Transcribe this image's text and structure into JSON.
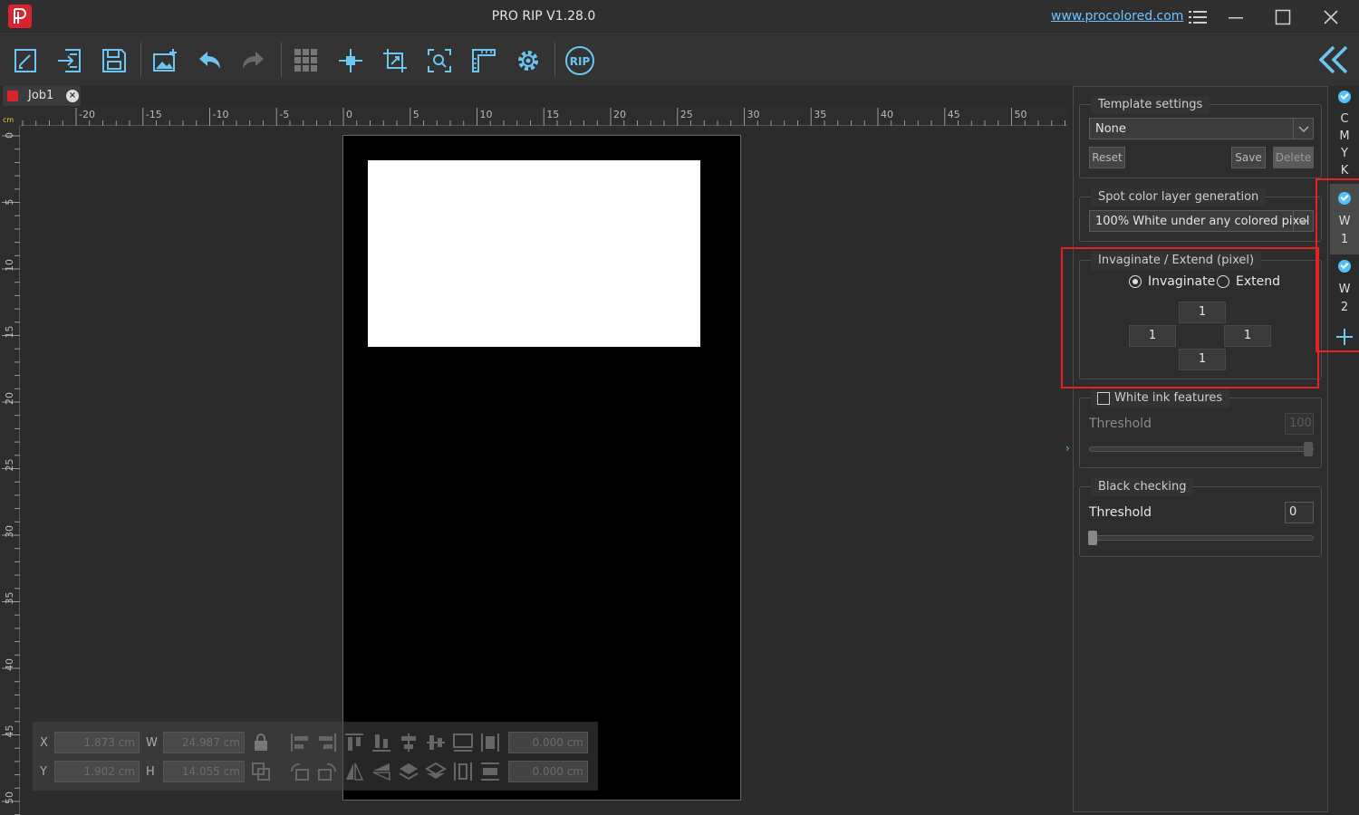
{
  "window": {
    "title": "PRO RIP V1.28.0",
    "website": "www.procolored.com",
    "icons": [
      "menu-icon",
      "minimize-icon",
      "maximize-icon",
      "close-icon"
    ]
  },
  "toolbar": {
    "tools": [
      "new-job-icon",
      "import-icon",
      "save-icon",
      "add-image-icon",
      "undo-icon",
      "redo-icon",
      "grid-icon",
      "center-icon",
      "crop-icon",
      "zoom-fit-icon",
      "ruler-icon",
      "settings-icon",
      "rip-icon"
    ],
    "rip_label": "RIP"
  },
  "tabs": [
    {
      "label": "Job1"
    }
  ],
  "ruler": {
    "unit": "cm",
    "h_labels": [
      "-20",
      "-15",
      "-10",
      "-5",
      "0",
      "5",
      "10",
      "15",
      "20",
      "25",
      "30",
      "35",
      "40",
      "45",
      "50"
    ],
    "v_labels": [
      "0",
      "5",
      "10",
      "15",
      "20",
      "25",
      "30",
      "35",
      "40",
      "45",
      "50"
    ]
  },
  "transform": {
    "x_label": "X",
    "x_value": "1.873 cm",
    "y_label": "Y",
    "y_value": "1.902 cm",
    "w_label": "W",
    "w_value": "24.987 cm",
    "h_label": "H",
    "h_value": "14.055 cm",
    "field1_value": "0.000 cm",
    "field2_value": "0.000 cm"
  },
  "panel": {
    "template": {
      "title": "Template settings",
      "selected": "None",
      "reset": "Reset",
      "save": "Save",
      "delete": "Delete"
    },
    "spot": {
      "title": "Spot color layer generation",
      "selected": "100% White under any colored pixel"
    },
    "invaginate": {
      "title": "Invaginate / Extend (pixel)",
      "option1": "Invaginate",
      "option2": "Extend",
      "selected": "Invaginate",
      "top": "1",
      "left": "1",
      "right": "1",
      "bottom": "1"
    },
    "white_ink": {
      "title": "White ink features",
      "checked": false,
      "threshold_label": "Threshold",
      "threshold_value": "100",
      "threshold_fraction": 1.0
    },
    "black": {
      "title": "Black checking",
      "threshold_label": "Threshold",
      "threshold_value": "0",
      "threshold_fraction": 0.0
    }
  },
  "channels": {
    "cmyk": [
      "C",
      "M",
      "Y",
      "K"
    ],
    "w1": [
      "W",
      "1"
    ],
    "w2": [
      "W",
      "2"
    ],
    "add_icon": "plus-icon"
  },
  "colors": {
    "accent": "#4fc3f7",
    "brand": "#d9232e",
    "highlight": "#e52222"
  }
}
